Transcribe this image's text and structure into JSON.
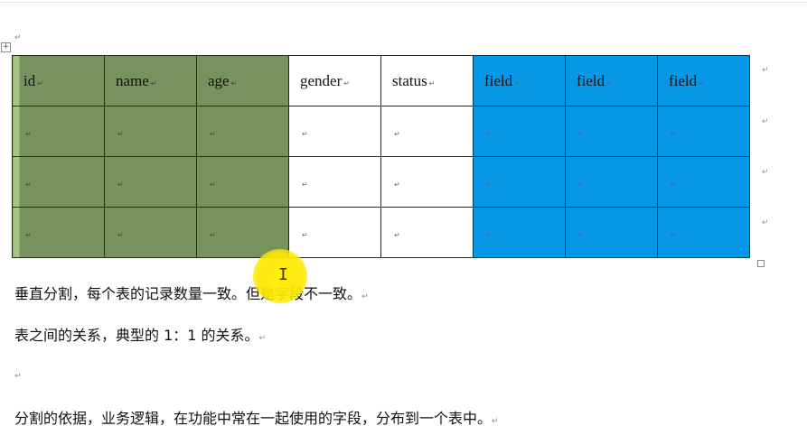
{
  "table": {
    "header": [
      {
        "text": "id",
        "color": "green"
      },
      {
        "text": "name",
        "color": "green"
      },
      {
        "text": "age",
        "color": "green"
      },
      {
        "text": "gender",
        "color": "white"
      },
      {
        "text": "status",
        "color": "white"
      },
      {
        "text": "field",
        "color": "blue"
      },
      {
        "text": "field",
        "color": "blue"
      },
      {
        "text": "field",
        "color": "blue"
      }
    ],
    "body_rows": 3,
    "colors": {
      "green": "#77925c",
      "blue": "#0896e6",
      "white": "#ffffff"
    }
  },
  "paragraph_mark": "↵",
  "paragraphs": {
    "p1": "垂直分割，每个表的记录数量一致。但是字段不一致。",
    "p2": "表之间的关系，典型的 1：1 的关系。",
    "p3": "",
    "p4": "分割的依据，业务逻辑，在功能中常在一起使用的字段，分布到一个表中。"
  },
  "icons": {
    "table_handle": "table-move-handle-icon",
    "resize_handle": "table-resize-handle-icon",
    "cursor": "text-cursor-icon"
  }
}
